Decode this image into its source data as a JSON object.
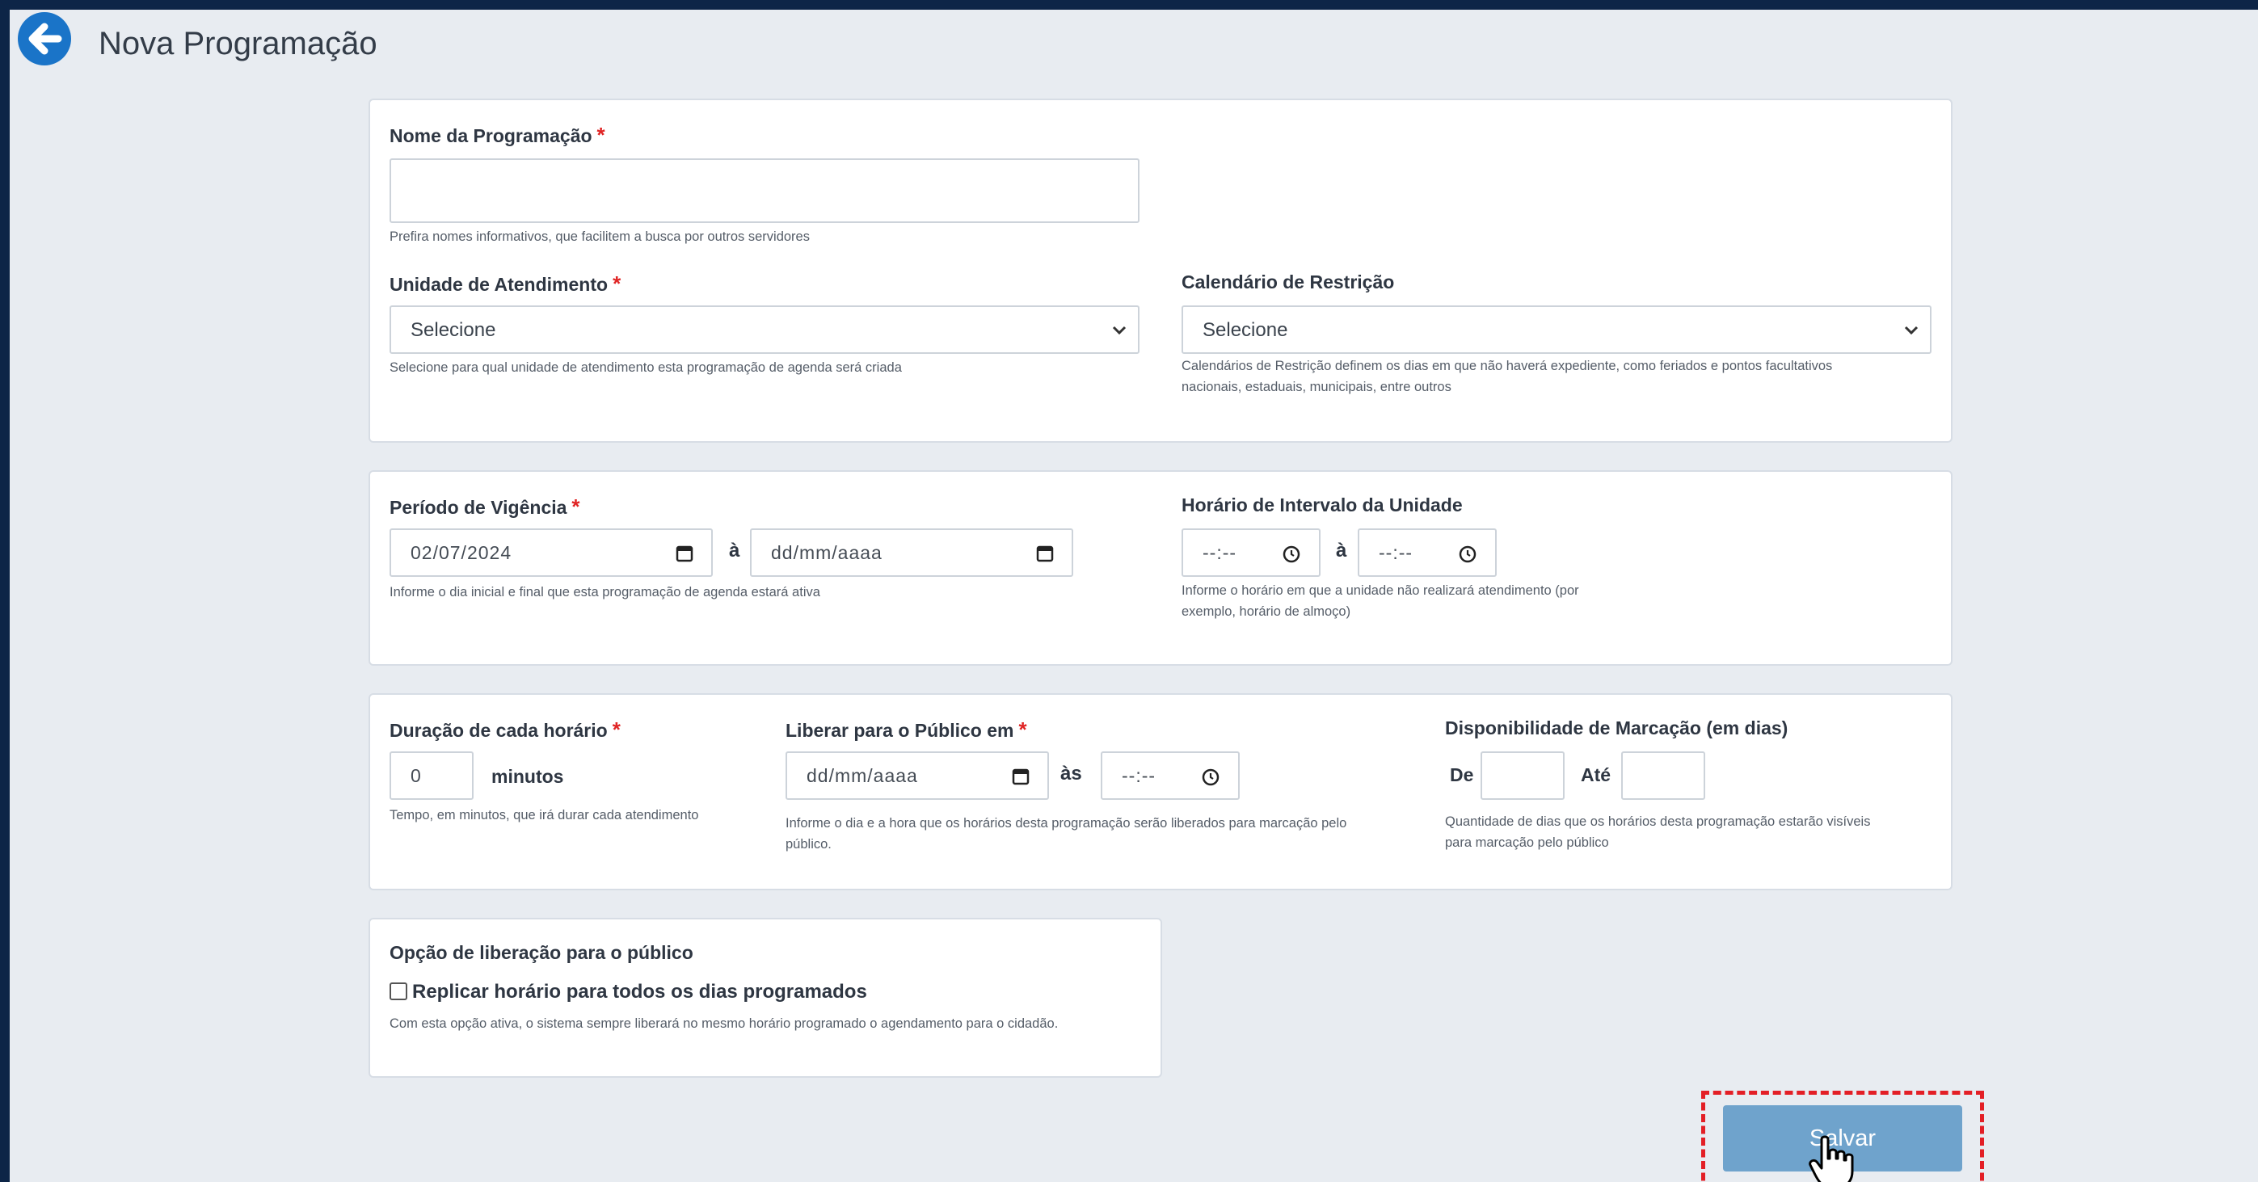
{
  "header": {
    "title": "Nova Programação"
  },
  "nome": {
    "label": "Nome da Programação",
    "value": "",
    "help": "Prefira nomes informativos, que facilitem a busca por outros servidores"
  },
  "unidade": {
    "label": "Unidade de Atendimento",
    "selected": "Selecione",
    "help": "Selecione para qual unidade de atendimento esta programação de agenda será criada"
  },
  "calendario": {
    "label": "Calendário de Restrição",
    "selected": "Selecione",
    "help_line1": "Calendários de Restrição definem os dias em que não haverá expediente, como feriados e pontos facultativos",
    "help_line2": "nacionais, estaduais, municipais, entre outros"
  },
  "periodo": {
    "label": "Período de Vigência",
    "start": "02/07/2024",
    "sep": "à",
    "end": "dd/mm/aaaa",
    "help": "Informe o dia inicial e final que esta programação de agenda estará ativa"
  },
  "intervalo": {
    "label": "Horário de Intervalo da Unidade",
    "start": "--:--",
    "sep": "à",
    "end": "--:--",
    "help_line1": "Informe o horário em que a unidade não realizará atendimento (por",
    "help_line2": "exemplo, horário de almoço)"
  },
  "duracao": {
    "label": "Duração de cada horário",
    "value": "0",
    "unit": "minutos",
    "help": "Tempo, em minutos, que irá durar cada atendimento"
  },
  "liberar": {
    "label": "Liberar para o Público em",
    "date": "dd/mm/aaaa",
    "sep": "às",
    "time": "--:--",
    "help_line1": "Informe o dia e a hora que os horários desta programação serão liberados para marcação pelo",
    "help_line2": "público."
  },
  "disponibilidade": {
    "label": "Disponibilidade de Marcação (em dias)",
    "de_label": "De",
    "de_value": "",
    "ate_label": "Até",
    "ate_value": "",
    "help_line1": "Quantidade de dias que os horários desta programação estarão visíveis",
    "help_line2": "para marcação pelo público"
  },
  "opcao": {
    "label": "Opção de liberação para o público",
    "checkbox_label": "Replicar horário para todos os dias programados",
    "checked": false,
    "help": "Com esta opção ativa, o sistema sempre liberará no mesmo horário programado o agendamento para o cidadão."
  },
  "save": {
    "label": "Salvar"
  },
  "colors": {
    "accent": "#1a74c8",
    "required": "#e02424",
    "button": "#6fa3cc",
    "highlight": "#e31f26"
  },
  "icons": [
    "arrow-left-icon",
    "chevron-down-icon",
    "calendar-icon",
    "clock-icon",
    "pointer-hand-icon"
  ]
}
